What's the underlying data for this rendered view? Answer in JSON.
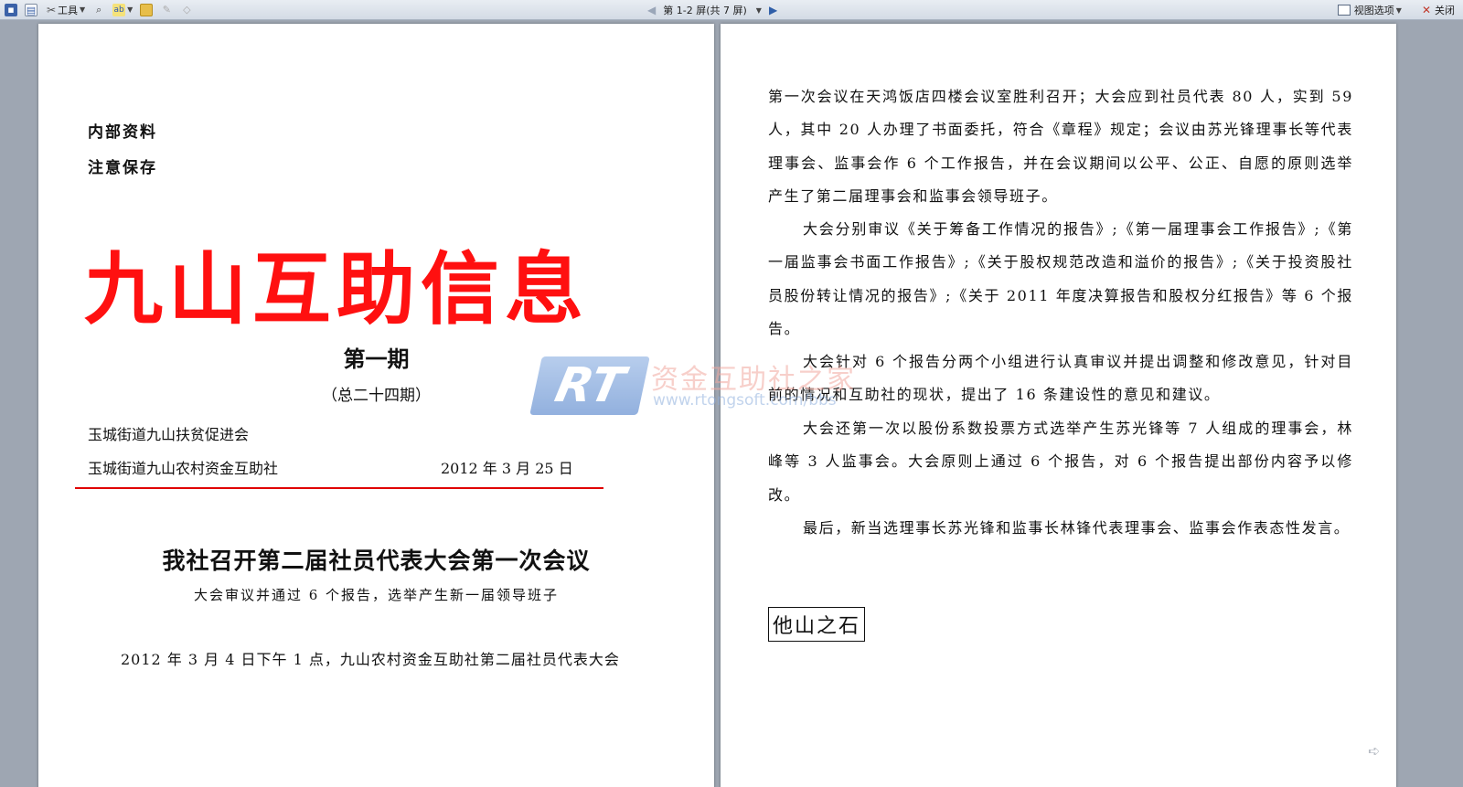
{
  "toolbar": {
    "tools_label": "工具",
    "spell_label": "ab",
    "page_indicator": "第 1-2 屏(共 7 屏)",
    "view_options_label": "视图选项",
    "close_label": "关闭"
  },
  "left_page": {
    "internal_line1": "内部资料",
    "internal_line2": "注意保存",
    "masthead": "九山互助信息",
    "issue": "第一期",
    "issue_total": "（总二十四期）",
    "org1": "玉城街道九山扶贫促进会",
    "org2": "玉城街道九山农村资金互助社",
    "date": "2012 年 3 月 25 日",
    "article_title": "我社召开第二届社员代表大会第一次会议",
    "article_subtitle": "大会审议并通过 6 个报告，选举产生新一届领导班子",
    "lead_line": "2012 年 3 月 4 日下午 1 点，九山农村资金互助社第二届社员代表大会"
  },
  "right_page": {
    "para1": "第一次会议在天鸿饭店四楼会议室胜利召开；大会应到社员代表 80 人，实到 59 人，其中 20 人办理了书面委托，符合《章程》规定；会议由苏光锋理事长等代表理事会、监事会作 6 个工作报告，并在会议期间以公平、公正、自愿的原则选举产生了第二届理事会和监事会领导班子。",
    "para2": "大会分别审议《关于筹备工作情况的报告》;《第一届理事会工作报告》;《第一届监事会书面工作报告》;《关于股权规范改造和溢价的报告》;《关于投资股社员股份转让情况的报告》;《关于 2011 年度决算报告和股权分红报告》等 6 个报告。",
    "para3": "大会针对 6 个报告分两个小组进行认真审议并提出调整和修改意见，针对目前的情况和互助社的现状，提出了 16 条建设性的意见和建议。",
    "para4": "大会还第一次以股份系数投票方式选举产生苏光锋等 7 人组成的理事会，林峰等 3 人监事会。大会原则上通过 6 个报告，对 6 个报告提出部份内容予以修改。",
    "para5": "最后，新当选理事长苏光锋和监事长林锋代表理事会、监事会作表态性发言。",
    "box_title": "他山之石"
  },
  "watermark": {
    "logo_text": "RT",
    "cn_text": "资金互助社之家",
    "url_text": "www.rtongsoft.com/bbs"
  }
}
